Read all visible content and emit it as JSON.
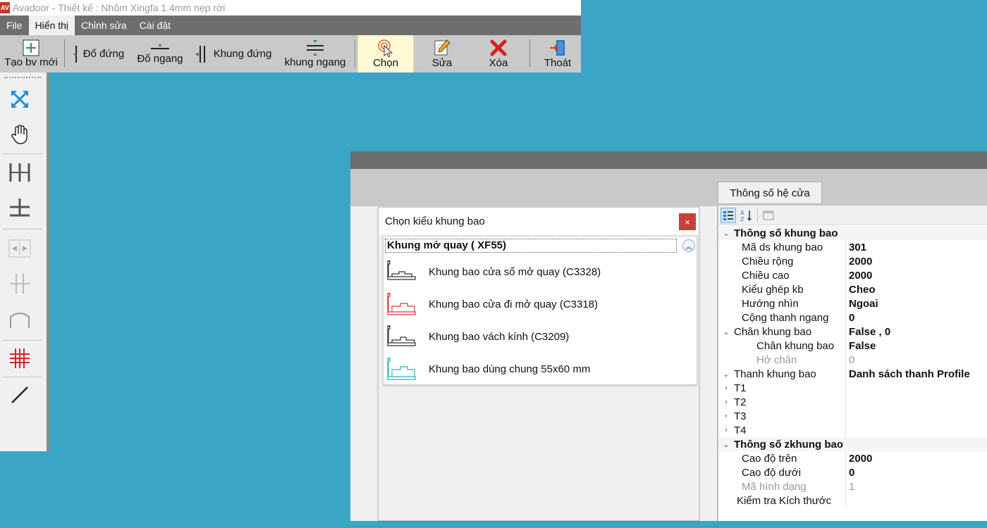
{
  "window": {
    "title": "Avadoor - Thiết kế : Nhôm Xingfa 1.4mm nẹp rời",
    "logo": "AV"
  },
  "menu": [
    "File",
    "Hiển thị",
    "Chỉnh sửa",
    "Cài đặt"
  ],
  "toolbar": {
    "new": "Tạo bv mới",
    "do_dung": "Đố đứng",
    "do_ngang": "Đố ngang",
    "khung_dung": "Khung đứng",
    "khung_ngang": "khung ngang",
    "chon": "Chọn",
    "sua": "Sửa",
    "xoa": "Xóa",
    "thoat": "Thoát"
  },
  "design": {
    "tab_label": "Thông số hệ cửa"
  },
  "dialog": {
    "title": "Chọn kiểu khung bao",
    "close": "×",
    "group": "Khung mở quay ( XF55)",
    "items": [
      {
        "label": "Khung bao cửa sổ mở quay (C3328)",
        "color": "#333333"
      },
      {
        "label": "Khung bao cửa đi mở quay  (C3318)",
        "color": "#d63a3a"
      },
      {
        "label": "Khung bao vách kính  (C3209)",
        "color": "#333333"
      },
      {
        "label": "Khung bao dùng chung 55x60 mm",
        "color": "#2bb3c0"
      }
    ]
  },
  "props": [
    {
      "type": "cat",
      "exp": "⌄",
      "name": "Thông số khung bao",
      "value": ""
    },
    {
      "type": "prop",
      "name": "Mã ds khung bao",
      "value": "301"
    },
    {
      "type": "prop",
      "name": "Chiều rộng",
      "value": "2000"
    },
    {
      "type": "prop",
      "name": "Chiều cao",
      "value": "2000"
    },
    {
      "type": "prop",
      "name": "Kiểu ghép kb",
      "value": "Cheo"
    },
    {
      "type": "prop",
      "name": "Hướng nhìn",
      "value": "Ngoai"
    },
    {
      "type": "prop",
      "name": "Cộng thanh ngang",
      "value": "0"
    },
    {
      "type": "sub",
      "exp": "⌄",
      "name": "Chân khung bao",
      "value": "False , 0"
    },
    {
      "type": "sub2",
      "name": "Chân khung bao",
      "value": "False"
    },
    {
      "type": "sub2grey",
      "name": "Hở chân",
      "value": "0"
    },
    {
      "type": "sub",
      "exp": "⌄",
      "name": "Thanh khung bao",
      "value": "Danh sách thanh Profile"
    },
    {
      "type": "leaf",
      "exp": "›",
      "name": "T1",
      "value": ""
    },
    {
      "type": "leaf",
      "exp": "›",
      "name": "T2",
      "value": ""
    },
    {
      "type": "leaf",
      "exp": "›",
      "name": "T3",
      "value": ""
    },
    {
      "type": "leaf",
      "exp": "›",
      "name": "T4",
      "value": ""
    },
    {
      "type": "cat",
      "exp": "⌄",
      "name": "Thông số zkhung bao",
      "value": ""
    },
    {
      "type": "prop",
      "name": "Cao độ trên",
      "value": "2000"
    },
    {
      "type": "prop",
      "name": "Cao độ dưới",
      "value": "0"
    },
    {
      "type": "propgrey",
      "name": "Mã hình dạng",
      "value": "1"
    },
    {
      "type": "plain",
      "name": "Kiểm tra Kích thước",
      "value": ""
    }
  ]
}
